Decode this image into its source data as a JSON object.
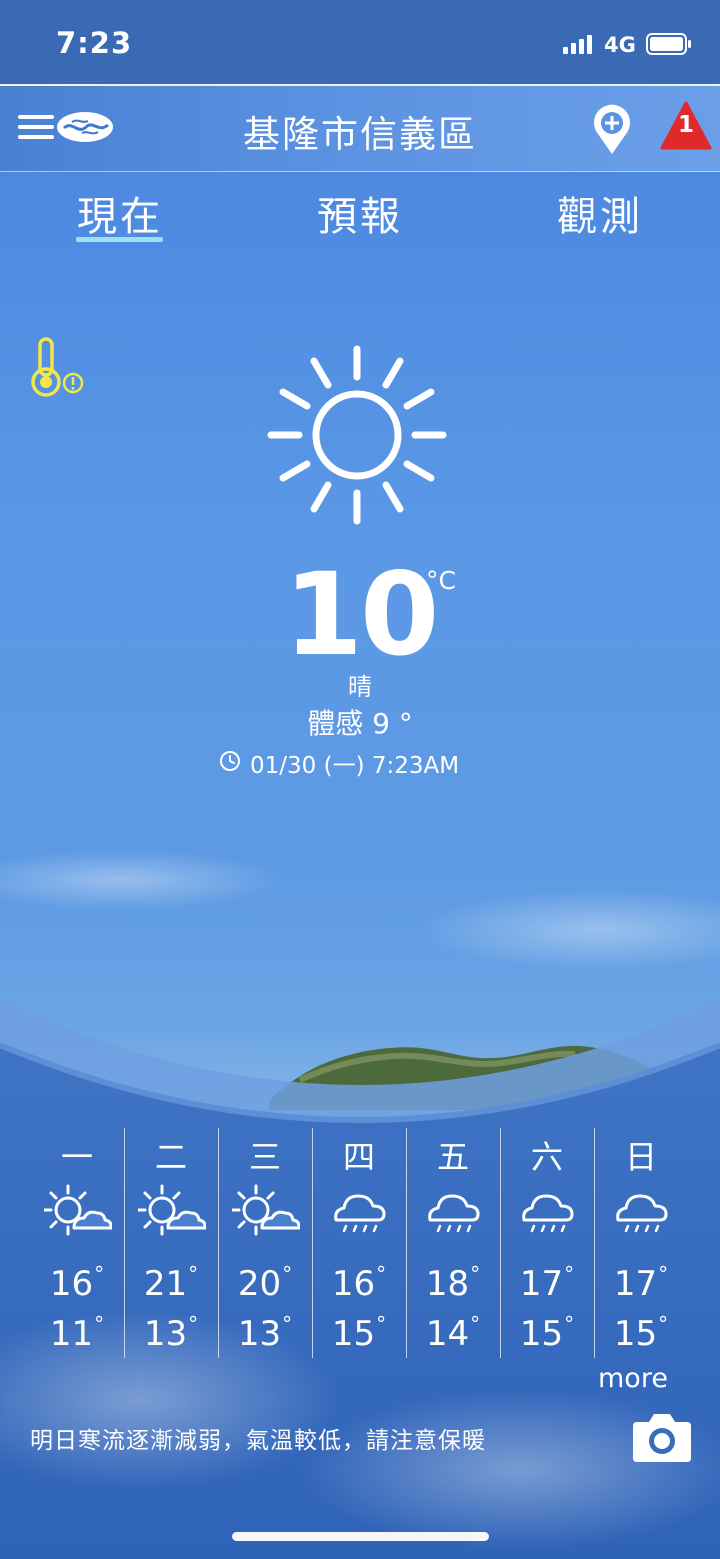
{
  "status_bar": {
    "time": "7:23",
    "network": "4G"
  },
  "header": {
    "location": "基隆市信義區",
    "alert_count": "1"
  },
  "tabs": [
    {
      "label": "現在",
      "active": true
    },
    {
      "label": "預報",
      "active": false
    },
    {
      "label": "觀測",
      "active": false
    }
  ],
  "current": {
    "temperature": "10",
    "unit": "°C",
    "condition": "晴",
    "feels_like": "體感 9 °",
    "updated": "01/30 (一) 7:23AM"
  },
  "weekly": [
    {
      "day": "一",
      "icon": "partly-sunny-icon",
      "high": "16",
      "low": "11"
    },
    {
      "day": "二",
      "icon": "partly-sunny-icon",
      "high": "21",
      "low": "13"
    },
    {
      "day": "三",
      "icon": "partly-sunny-icon",
      "high": "20",
      "low": "13"
    },
    {
      "day": "四",
      "icon": "rain-cloud-icon",
      "high": "16",
      "low": "15"
    },
    {
      "day": "五",
      "icon": "rain-cloud-icon",
      "high": "18",
      "low": "14"
    },
    {
      "day": "六",
      "icon": "rain-cloud-icon",
      "high": "17",
      "low": "15"
    },
    {
      "day": "日",
      "icon": "rain-cloud-icon",
      "high": "17",
      "low": "15"
    }
  ],
  "more_label": "more",
  "advisory": "明日寒流逐漸減弱，氣溫較低，請注意保暖",
  "colors": {
    "status_bar": "#3a6ab4",
    "tab_underline": "#9fe0f0",
    "alert": "#e02a2a",
    "temp_warning": "#f2e64a"
  }
}
